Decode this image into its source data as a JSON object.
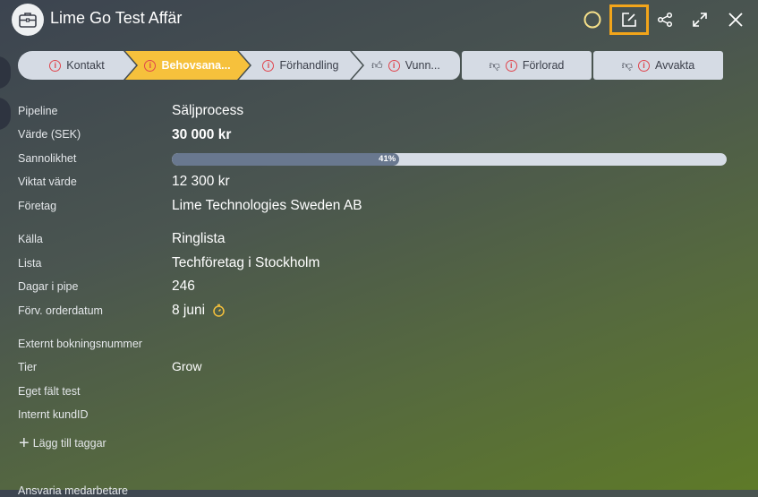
{
  "header": {
    "title": "Lime Go Test Affär"
  },
  "pipeline": {
    "stages": [
      {
        "label": "Kontakt",
        "active": false,
        "icon": "info"
      },
      {
        "label": "Behovsana...",
        "active": true,
        "icon": "info"
      },
      {
        "label": "Förhandling",
        "active": false,
        "icon": "info"
      },
      {
        "label": "Vunn...",
        "active": false,
        "icon": "thumbs-up"
      },
      {
        "label": "Förlorad",
        "active": false,
        "icon": "thumbs-down"
      },
      {
        "label": "Avvakta",
        "active": false,
        "icon": "thumbs-down"
      }
    ]
  },
  "details": {
    "pipeline_label": "Pipeline",
    "pipeline_value": "Säljprocess",
    "value_label": "Värde (SEK)",
    "value_value": "30 000 kr",
    "prob_label": "Sannolikhet",
    "prob_value": "41%",
    "prob_fraction": 0.41,
    "weighted_label": "Viktat värde",
    "weighted_value": "12 300 kr",
    "company_label": "Företag",
    "company_value": "Lime Technologies Sweden AB",
    "source_label": "Källa",
    "source_value": "Ringlista",
    "list_label": "Lista",
    "list_value": "Techföretag i Stockholm",
    "days_label": "Dagar i pipe",
    "days_value": "246",
    "order_label": "Förv. orderdatum",
    "order_value": "8 juni",
    "extbook_label": "Externt bokningsnummer",
    "tier_label": "Tier",
    "tier_value": "Grow",
    "ownfield_label": "Eget fält test",
    "custid_label": "Internt kundID"
  },
  "tags": {
    "add_label": "Lägg till taggar"
  },
  "cut_label": "Ansvaria medarbetare",
  "colors": {
    "active_stage": "#f6c13c",
    "edit_highlight": "#f2a51a",
    "info_red": "#e0454d",
    "clock": "#f6c13c"
  }
}
